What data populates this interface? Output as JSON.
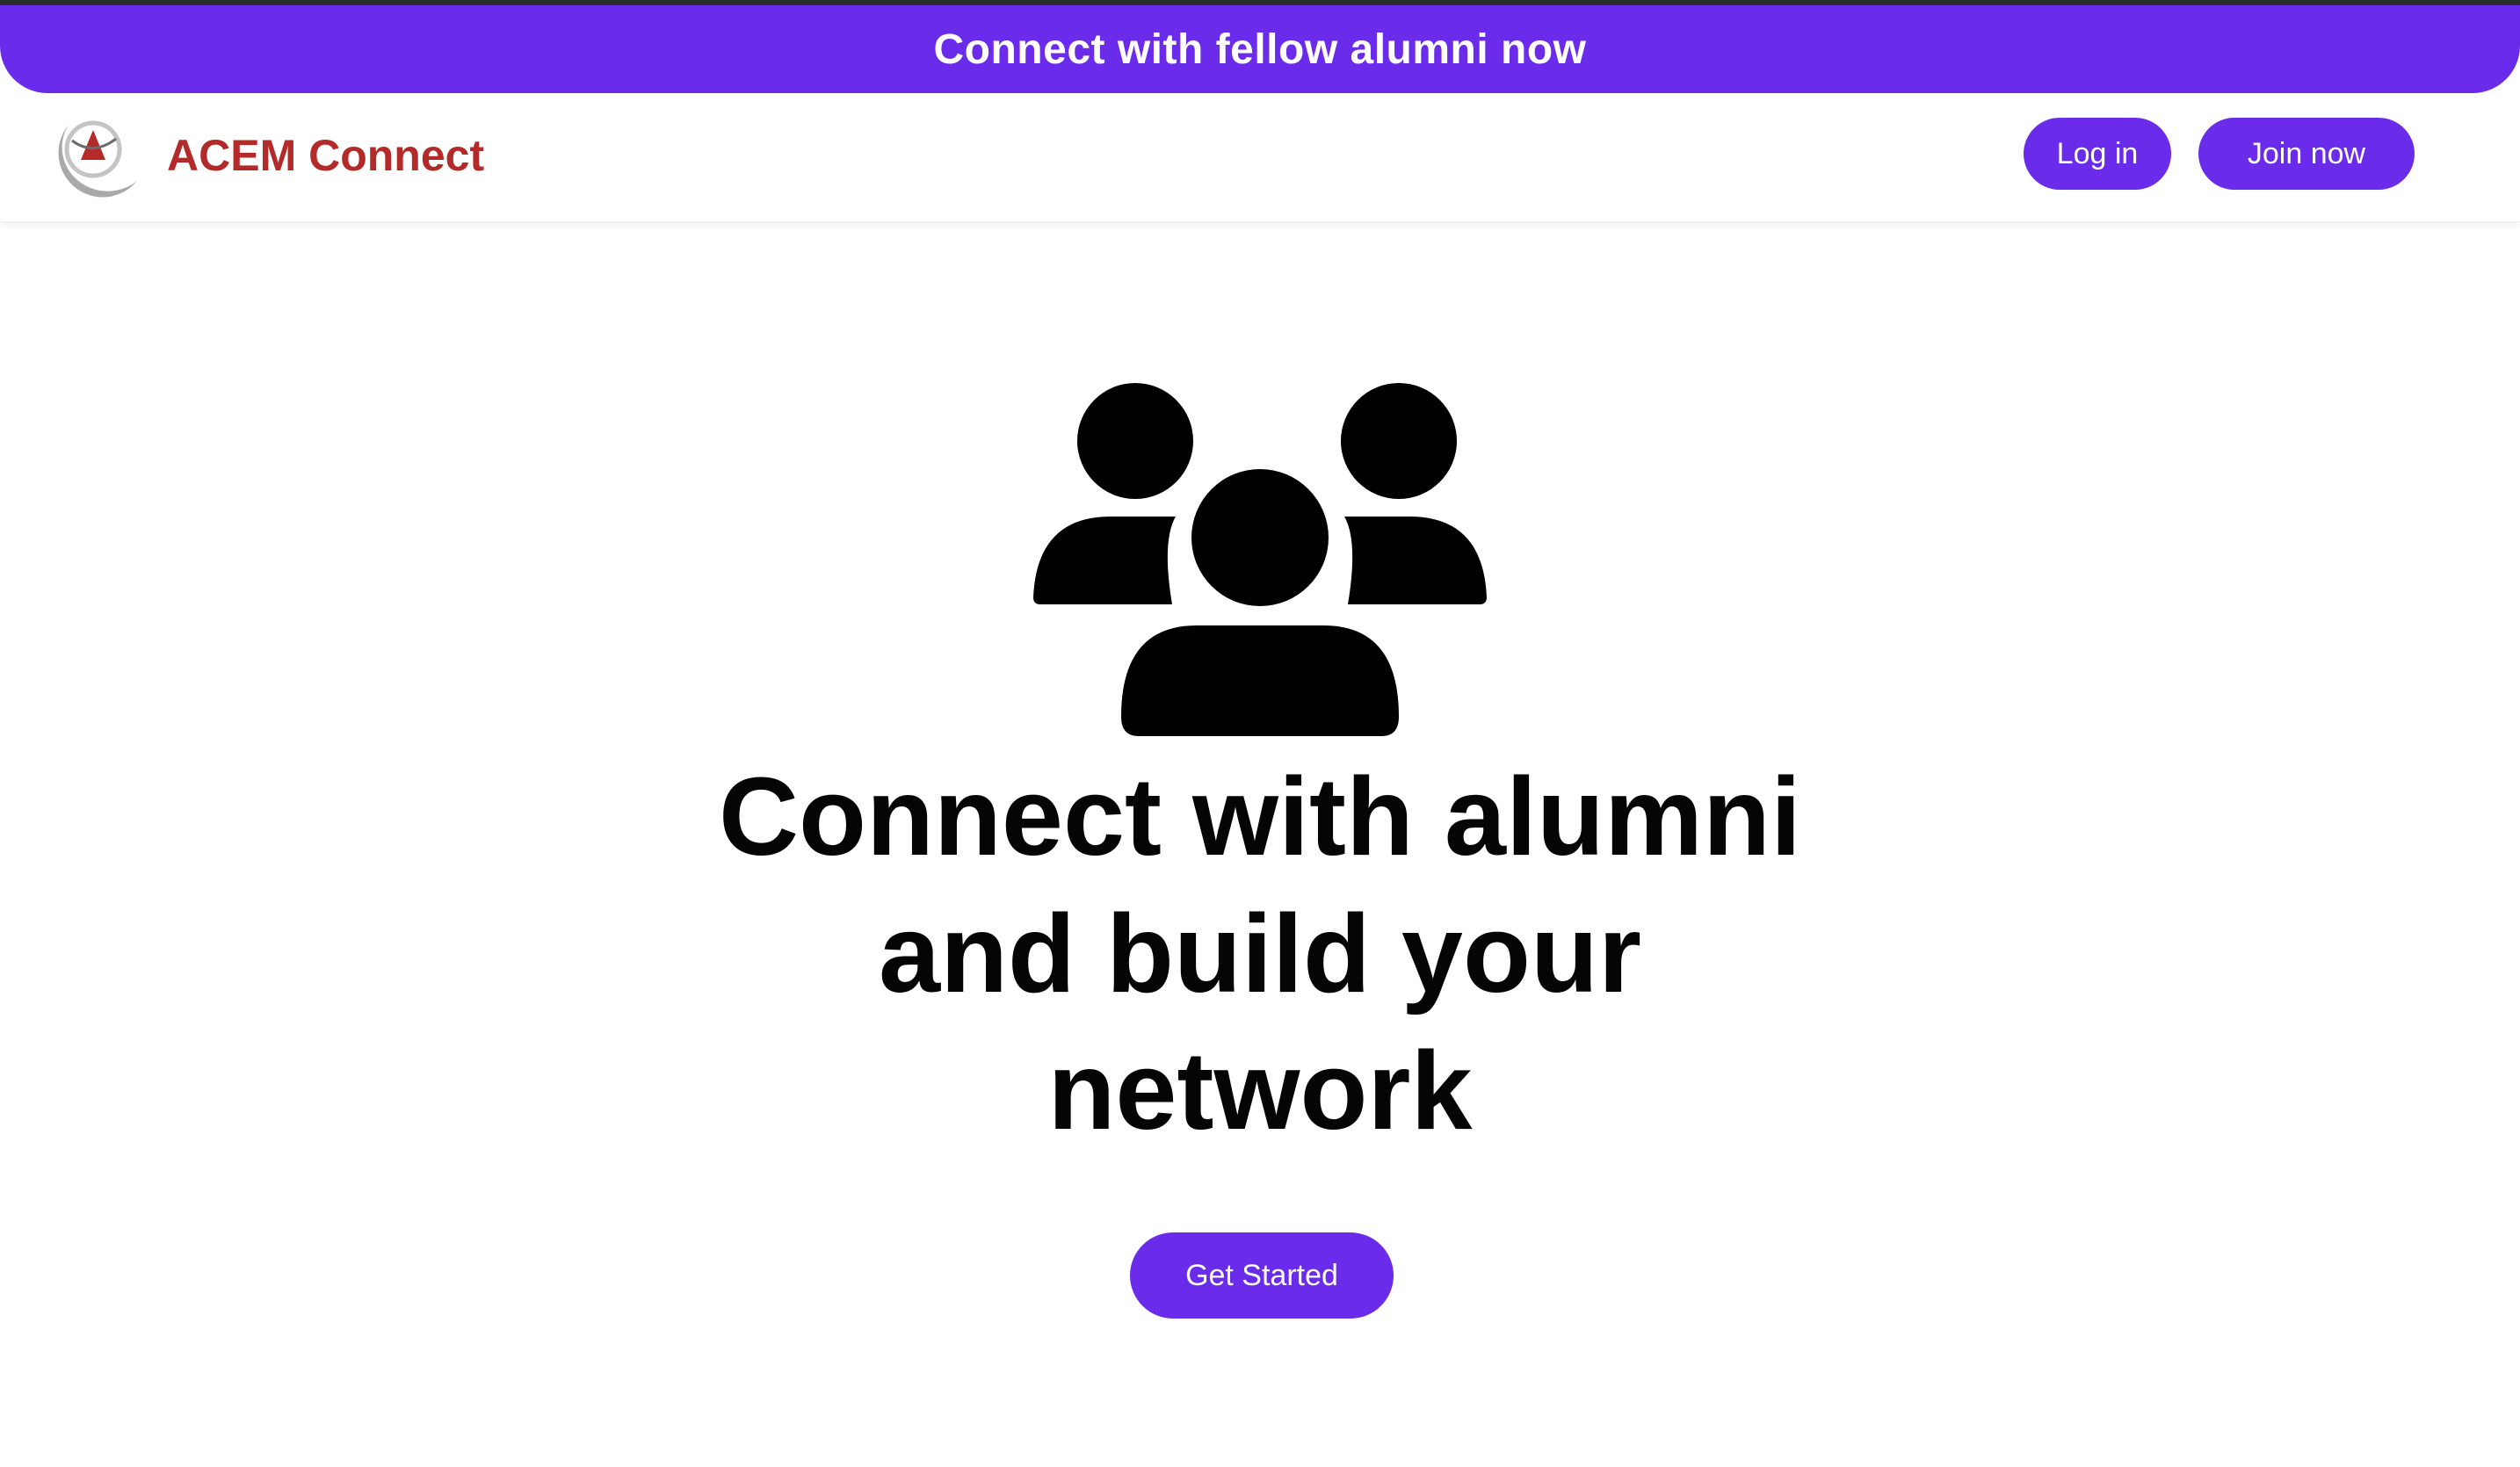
{
  "banner": {
    "text": "Connect with fellow alumni now"
  },
  "header": {
    "brand": "ACEM Connect",
    "login_label": "Log in",
    "join_label": "Join now"
  },
  "hero": {
    "icon": "users-group-icon",
    "title_lines": [
      "Connect with alumni",
      "and build your",
      "network"
    ],
    "cta_label": "Get Started"
  },
  "colors": {
    "accent": "#6a2bea",
    "brand": "#b22a2a",
    "text": "#050505"
  }
}
